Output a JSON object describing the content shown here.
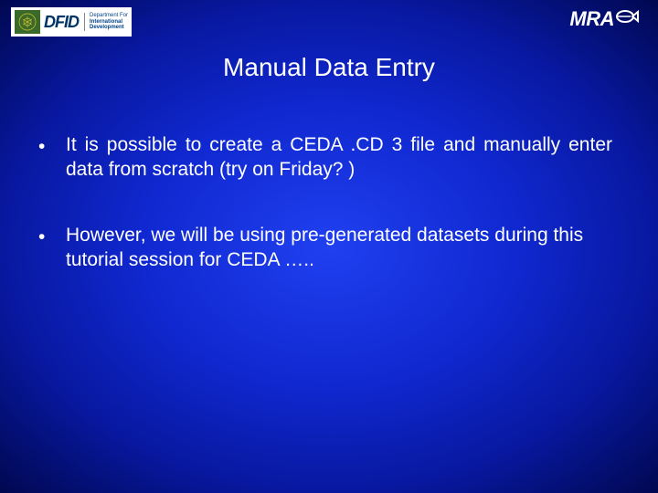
{
  "header": {
    "dfid_acronym": "DFID",
    "dfid_line1": "Department For",
    "dfid_line2": "International",
    "dfid_line3": "Development",
    "mrag_label": "MRA"
  },
  "title": "Manual Data Entry",
  "bullets": [
    {
      "marker": "•",
      "text": "It is possible to create a CEDA .CD 3 file and manually enter data from scratch (try on Friday? )",
      "justified": true
    },
    {
      "marker": "•",
      "text": "However, we will be using pre-generated datasets during this tutorial session for CEDA …..",
      "justified": false
    }
  ]
}
